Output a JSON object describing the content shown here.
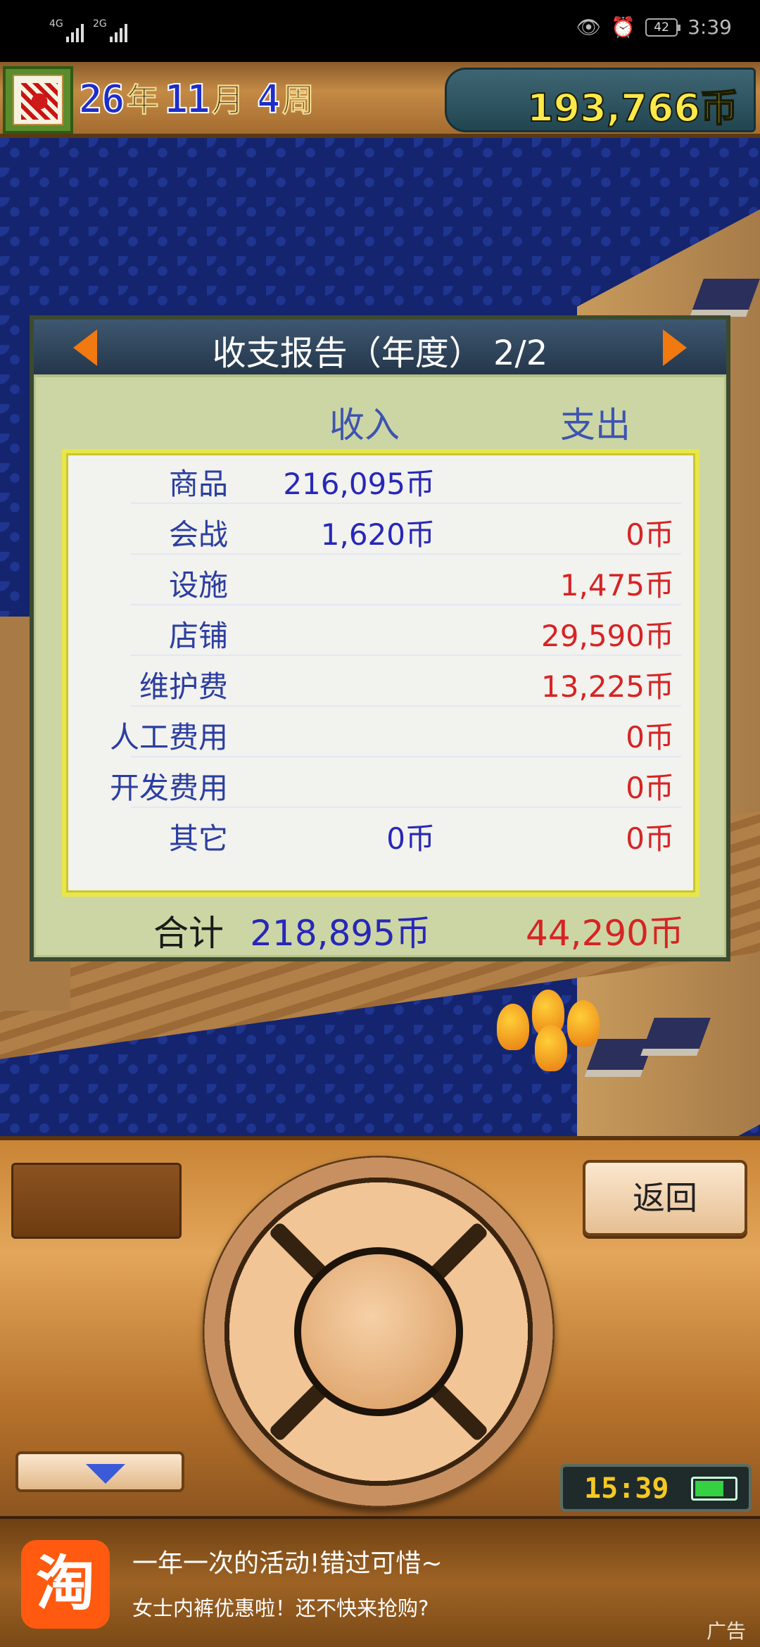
{
  "status_bar": {
    "net1": "4G",
    "net2": "2G",
    "battery": "42",
    "time": "3:39"
  },
  "header": {
    "year": "26",
    "year_unit": "年",
    "month": "11",
    "month_unit": "月",
    "week": "4",
    "week_unit": "周",
    "money": "193,766币"
  },
  "report": {
    "title": "收支报告（年度） 2/2",
    "col_income": "收入",
    "col_expense": "支出",
    "rows": [
      {
        "label": "商品",
        "income": "216,095币",
        "expense": ""
      },
      {
        "label": "会战",
        "income": "1,620币",
        "expense": "0币"
      },
      {
        "label": "设施",
        "income": "",
        "expense": "1,475币"
      },
      {
        "label": "店铺",
        "income": "",
        "expense": "29,590币"
      },
      {
        "label": "维护费",
        "income": "",
        "expense": "13,225币"
      },
      {
        "label": "人工费用",
        "income": "",
        "expense": "0币"
      },
      {
        "label": "开发费用",
        "income": "",
        "expense": "0币"
      },
      {
        "label": "其它",
        "income": "0币",
        "expense": "0币"
      }
    ],
    "total_label": "合计",
    "total_income": "218,895币",
    "total_expense": "44,290币"
  },
  "controls": {
    "back_label": "返回",
    "clock": "15:39"
  },
  "ad": {
    "icon_char": "淘",
    "line1": "一年一次的活动!错过可惜~",
    "line2": "女士内裤优惠啦！还不快来抢购?",
    "tag": "广告"
  },
  "colors": {
    "income": "#2727b8",
    "expense": "#d62424",
    "money": "#ffe94a"
  }
}
